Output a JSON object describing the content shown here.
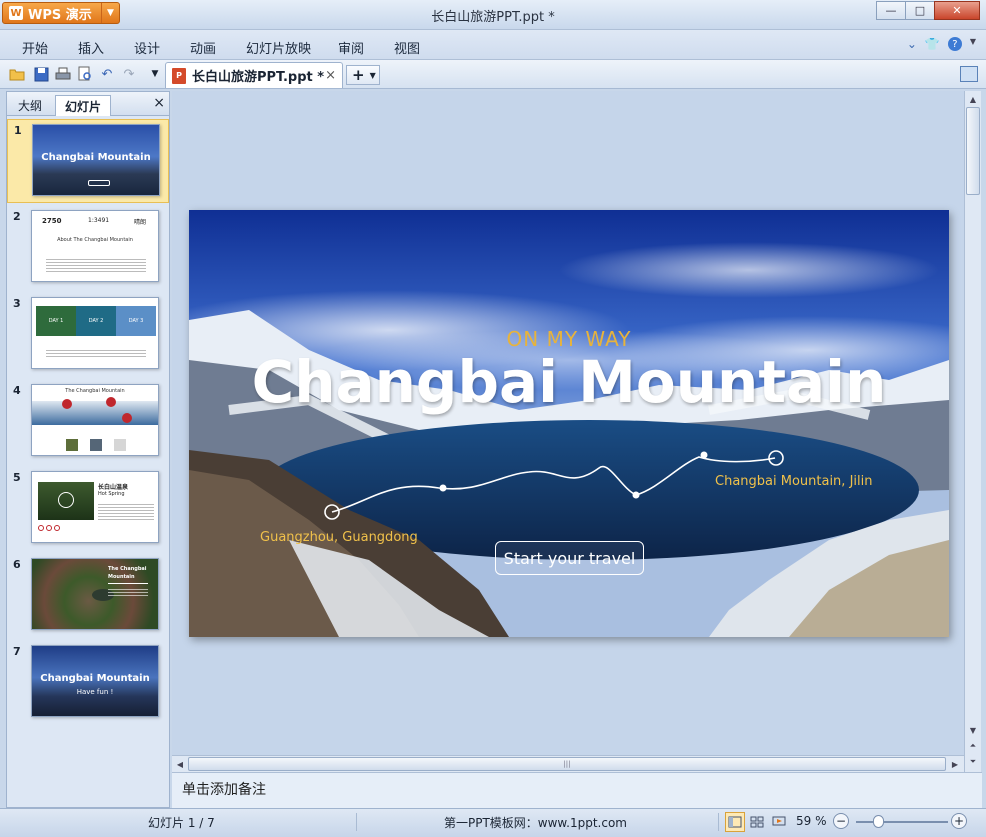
{
  "window": {
    "app_name": "WPS 演示",
    "app_logo": "W",
    "title": "长白山旅游PPT.ppt *",
    "controls": {
      "minimize": "—",
      "maximize": "□",
      "close": "✕"
    }
  },
  "menu": {
    "items": [
      "开始",
      "插入",
      "设计",
      "动画",
      "幻灯片放映",
      "审阅",
      "视图"
    ],
    "right_icons": [
      "chevron-down-icon",
      "shirt-icon",
      "help-icon"
    ]
  },
  "toolbar": {
    "icons": [
      "open-folder-icon",
      "save-icon",
      "print-icon",
      "print-preview-icon",
      "undo-icon",
      "redo-icon",
      "customize-icon"
    ],
    "doc_tab": {
      "label": "长白山旅游PPT.ppt *",
      "close": "×",
      "icon": "ppt-file-icon"
    },
    "new_tab": "+"
  },
  "left_panel": {
    "tabs": [
      "大纲",
      "幻灯片"
    ],
    "active_tab": "幻灯片",
    "close": "×",
    "slides": [
      {
        "num": "1",
        "title": "Changbai Mountain",
        "selected": true
      },
      {
        "num": "2",
        "title": "About The Changbai Mountain",
        "stats": [
          "2750",
          "1:3491",
          "晴朗"
        ]
      },
      {
        "num": "3",
        "captions": [
          "DAY 1",
          "DAY 2",
          "DAY 3"
        ]
      },
      {
        "num": "4",
        "title": "The Changbai Mountain"
      },
      {
        "num": "5",
        "title": "长白山温泉",
        "subtitle": "Hot Spring"
      },
      {
        "num": "6",
        "title": "The Changbai Mountain"
      },
      {
        "num": "7",
        "title": "Changbai Mountain",
        "subtitle": "Have fun !"
      }
    ]
  },
  "slide": {
    "kicker": "ON MY WAY",
    "title": "Changbai Mountain",
    "from_label": "Guangzhou, Guangdong",
    "to_label": "Changbai Mountain, Jilin",
    "cta": "Start your travel"
  },
  "notes": {
    "placeholder": "单击添加备注"
  },
  "status": {
    "slide_info": "幻灯片 1 / 7",
    "site": "第一PPT模板网：www.1ppt.com",
    "zoom": "59 %",
    "zoom_percent": 59,
    "zoom_minus": "−",
    "zoom_plus": "+"
  },
  "colors": {
    "accent": "#e0761a",
    "slide_gold": "#e7b33c",
    "chrome": "#c9d8ec"
  }
}
